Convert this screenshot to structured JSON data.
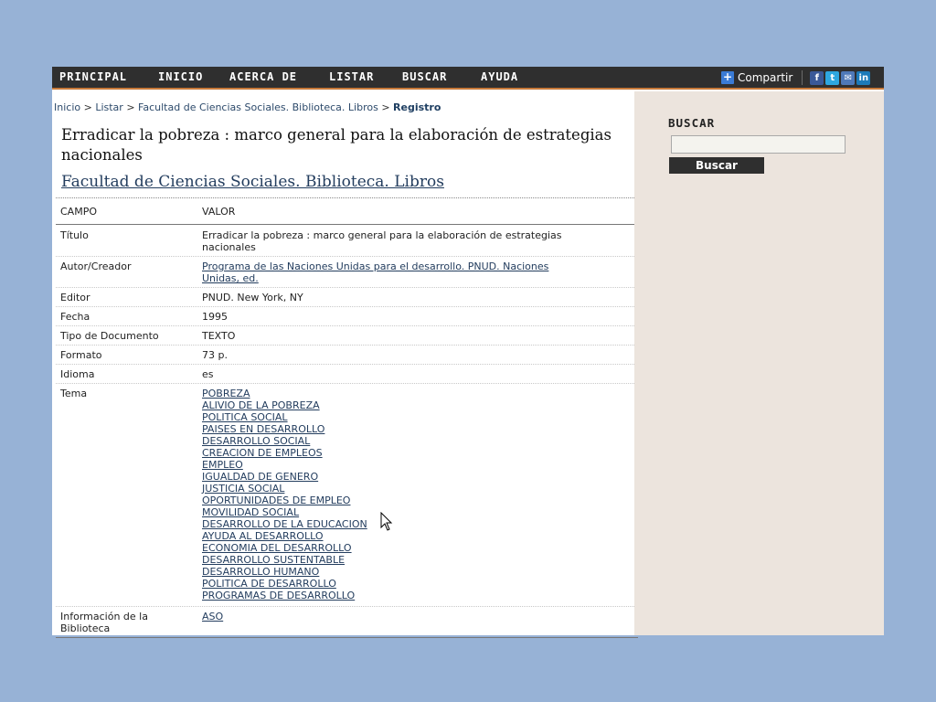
{
  "nav": {
    "items": [
      "PRINCIPAL",
      "INICIO",
      "ACERCA DE",
      "LISTAR",
      "BUSCAR",
      "AYUDA"
    ],
    "share_label": "Compartir",
    "social_icons": [
      "facebook-icon",
      "twitter-icon",
      "mail-icon",
      "linkedin-icon"
    ]
  },
  "breadcrumb": {
    "items": [
      "Inicio",
      "Listar",
      "Facultad de Ciencias Sociales. Biblioteca. Libros"
    ],
    "separator": ">",
    "current": "Registro"
  },
  "record": {
    "title": "Erradicar la pobreza : marco general para la elaboración de estrategias nacionales",
    "collection": "Facultad de Ciencias Sociales. Biblioteca. Libros",
    "header": {
      "field": "CAMPO",
      "value": "VALOR"
    },
    "rows": [
      {
        "field": "Título",
        "value": "Erradicar la pobreza : marco general para la elaboración de estrategias nacionales"
      },
      {
        "field": "Autor/Creador",
        "value": "Programa de las Naciones Unidas para el desarrollo. PNUD. Naciones Unidas, ed."
      },
      {
        "field": "Editor",
        "value": "PNUD. New York, NY"
      },
      {
        "field": "Fecha",
        "value": "1995"
      },
      {
        "field": "Tipo de Documento",
        "value": "TEXTO"
      },
      {
        "field": "Formato",
        "value": "73 p."
      },
      {
        "field": "Idioma",
        "value": "es"
      }
    ],
    "tema_label": "Tema",
    "temas": [
      "POBREZA",
      "ALIVIO DE LA POBREZA",
      "POLITICA SOCIAL",
      "PAISES EN DESARROLLO",
      "DESARROLLO SOCIAL",
      "CREACION DE EMPLEOS",
      "EMPLEO",
      "IGUALDAD DE GENERO",
      "JUSTICIA SOCIAL",
      "OPORTUNIDADES DE EMPLEO",
      "MOVILIDAD SOCIAL",
      "DESARROLLO DE LA EDUCACION",
      "AYUDA AL DESARROLLO",
      "ECONOMIA DEL DESARROLLO",
      "DESARROLLO SUSTENTABLE",
      "DESARROLLO HUMANO",
      "POLITICA DE DESARROLLO",
      "PROGRAMAS DE DESARROLLO"
    ],
    "library": {
      "field": "Información de la Biblioteca",
      "value": "ASO"
    }
  },
  "sidebar": {
    "title": "BUSCAR",
    "search_value": "",
    "button_label": "Buscar"
  },
  "colors": {
    "background": "#97b2d6",
    "navbar": "#2f2f2f",
    "nav_accent": "#c87a3a",
    "sidebar": "#ece4dd",
    "link": "#233d5e"
  }
}
